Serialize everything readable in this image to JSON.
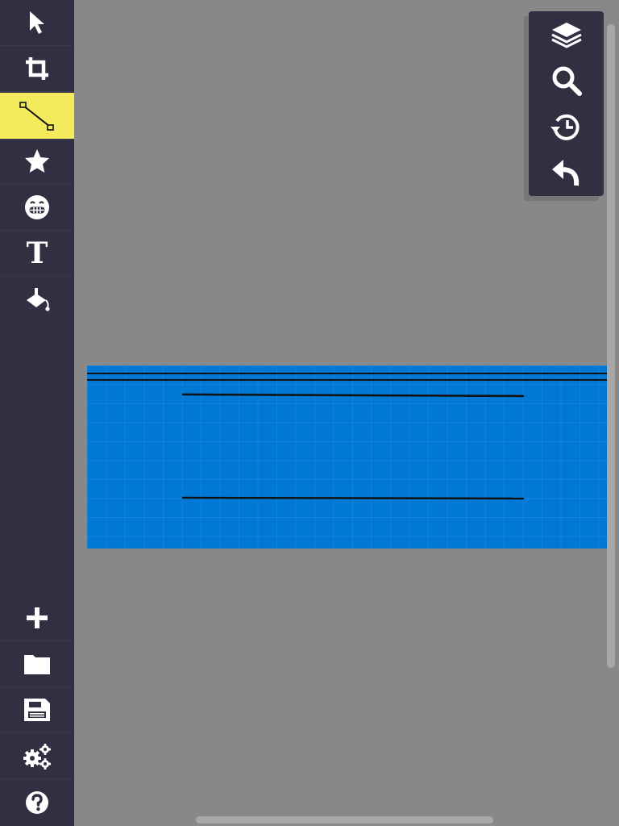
{
  "sidebar": {
    "top_tools": [
      {
        "icon": "pointer-icon",
        "active": false
      },
      {
        "icon": "crop-icon",
        "active": false
      },
      {
        "icon": "line-tool-icon",
        "active": true
      },
      {
        "icon": "star-icon",
        "active": false
      },
      {
        "icon": "emoji-icon",
        "active": false
      },
      {
        "icon": "text-icon",
        "active": false
      },
      {
        "icon": "paint-bucket-icon",
        "active": false
      }
    ],
    "bottom_tools": [
      {
        "icon": "plus-icon"
      },
      {
        "icon": "folder-icon"
      },
      {
        "icon": "save-icon"
      },
      {
        "icon": "settings-icon"
      },
      {
        "icon": "help-icon"
      }
    ],
    "active_color": "#f3ea5c",
    "background": "#313042"
  },
  "right_panel": {
    "tools": [
      {
        "icon": "layers-icon"
      },
      {
        "icon": "zoom-icon"
      },
      {
        "icon": "history-icon"
      },
      {
        "icon": "undo-icon"
      }
    ]
  },
  "text_tool_glyph": "T",
  "canvas": {
    "background": "#0078d4",
    "stroke_color": "#111111",
    "stroke_count": 4
  },
  "workspace_background": "#888888"
}
